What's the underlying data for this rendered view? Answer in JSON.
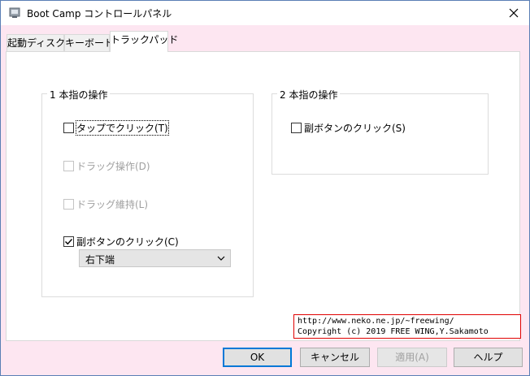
{
  "window": {
    "title": "Boot Camp コントロールパネル",
    "icon": "app-window-icon",
    "close_icon": "close-icon"
  },
  "tabs": [
    {
      "label": "起動ディスク",
      "active": false
    },
    {
      "label": "キーボード",
      "active": false
    },
    {
      "label": "トラックパッド",
      "active": true
    }
  ],
  "one_finger": {
    "title": "1 本指の操作",
    "tap_click": {
      "label": "タップでクリック(T)",
      "checked": false,
      "enabled": true
    },
    "drag": {
      "label": "ドラッグ操作(D)",
      "checked": false,
      "enabled": false
    },
    "drag_lock": {
      "label": "ドラッグ維持(L)",
      "checked": false,
      "enabled": false
    },
    "secondary_click": {
      "label": "副ボタンのクリック(C)",
      "checked": true,
      "enabled": true
    },
    "secondary_click_option": {
      "value": "右下端"
    }
  },
  "two_finger": {
    "title": "2 本指の操作",
    "secondary_click": {
      "label": "副ボタンのクリック(S)",
      "checked": false,
      "enabled": true
    }
  },
  "credit": {
    "line1": "http://www.neko.ne.jp/~freewing/",
    "line2": "Copyright (c) 2019 FREE WING,Y.Sakamoto"
  },
  "buttons": {
    "ok": "OK",
    "cancel": "キャンセル",
    "apply": "適用(A)",
    "help": "ヘルプ"
  },
  "colors": {
    "accent": "#0078d7",
    "background": "#fde6f1",
    "credit_border": "#e00000"
  }
}
